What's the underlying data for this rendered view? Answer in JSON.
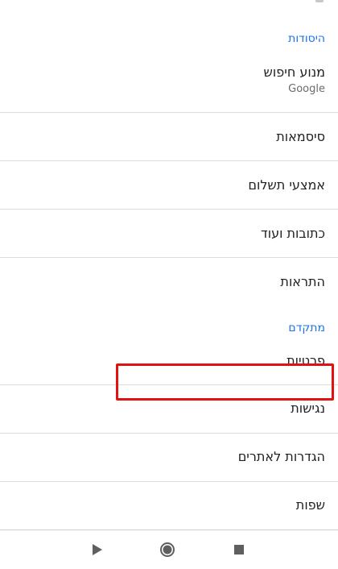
{
  "sections": {
    "basics_header": "היסודות",
    "advanced_header": "מתקדם"
  },
  "items": {
    "search_engine": {
      "label": "מנוע חיפוש",
      "value": "Google"
    },
    "passwords": "סיסמאות",
    "payment_methods": "אמצעי תשלום",
    "addresses": "כתובות ועוד",
    "notifications": "התראות",
    "privacy": "פרטיות",
    "accessibility": "נגישות",
    "site_settings": "הגדרות לאתרים",
    "languages": "שפות"
  },
  "colors": {
    "section_header": "#1a73e8",
    "highlight_box": "#e31212",
    "divider": "#dcdcdc"
  },
  "nav_bar": {
    "icons": [
      "back-triangle-icon",
      "home-circle-icon",
      "recents-square-icon"
    ]
  }
}
